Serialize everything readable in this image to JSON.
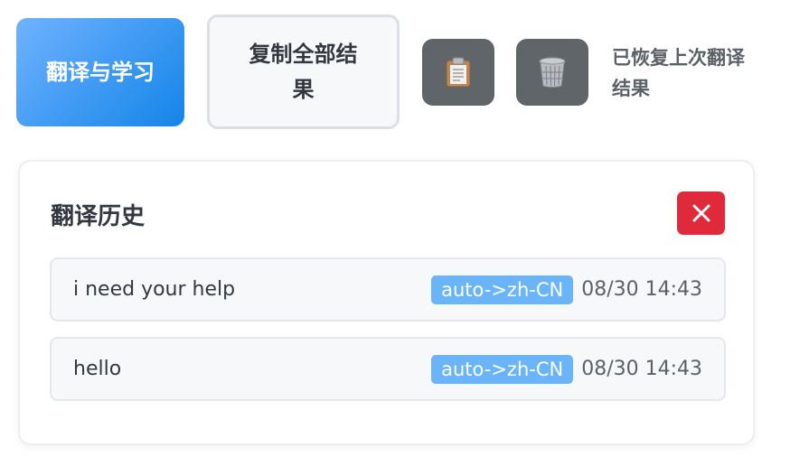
{
  "toolbar": {
    "translate_button_label": "翻译与学习",
    "copy_all_button_label": "复制全部结果",
    "paste_icon": "clipboard-icon",
    "clear_icon": "trash-icon",
    "status_message": "已恢复上次翻译结果"
  },
  "history": {
    "title": "翻译历史",
    "close_icon": "close-icon",
    "items": [
      {
        "text": "i need your help",
        "lang": "auto->zh-CN",
        "time": "08/30 14:43"
      },
      {
        "text": "hello",
        "lang": "auto->zh-CN",
        "time": "08/30 14:43"
      }
    ]
  },
  "colors": {
    "primary_gradient_start": "#6fb2ff",
    "primary_gradient_end": "#1485e8",
    "icon_button_bg": "#5f6569",
    "danger": "#e02a3c",
    "badge": "#6ab4fa"
  }
}
